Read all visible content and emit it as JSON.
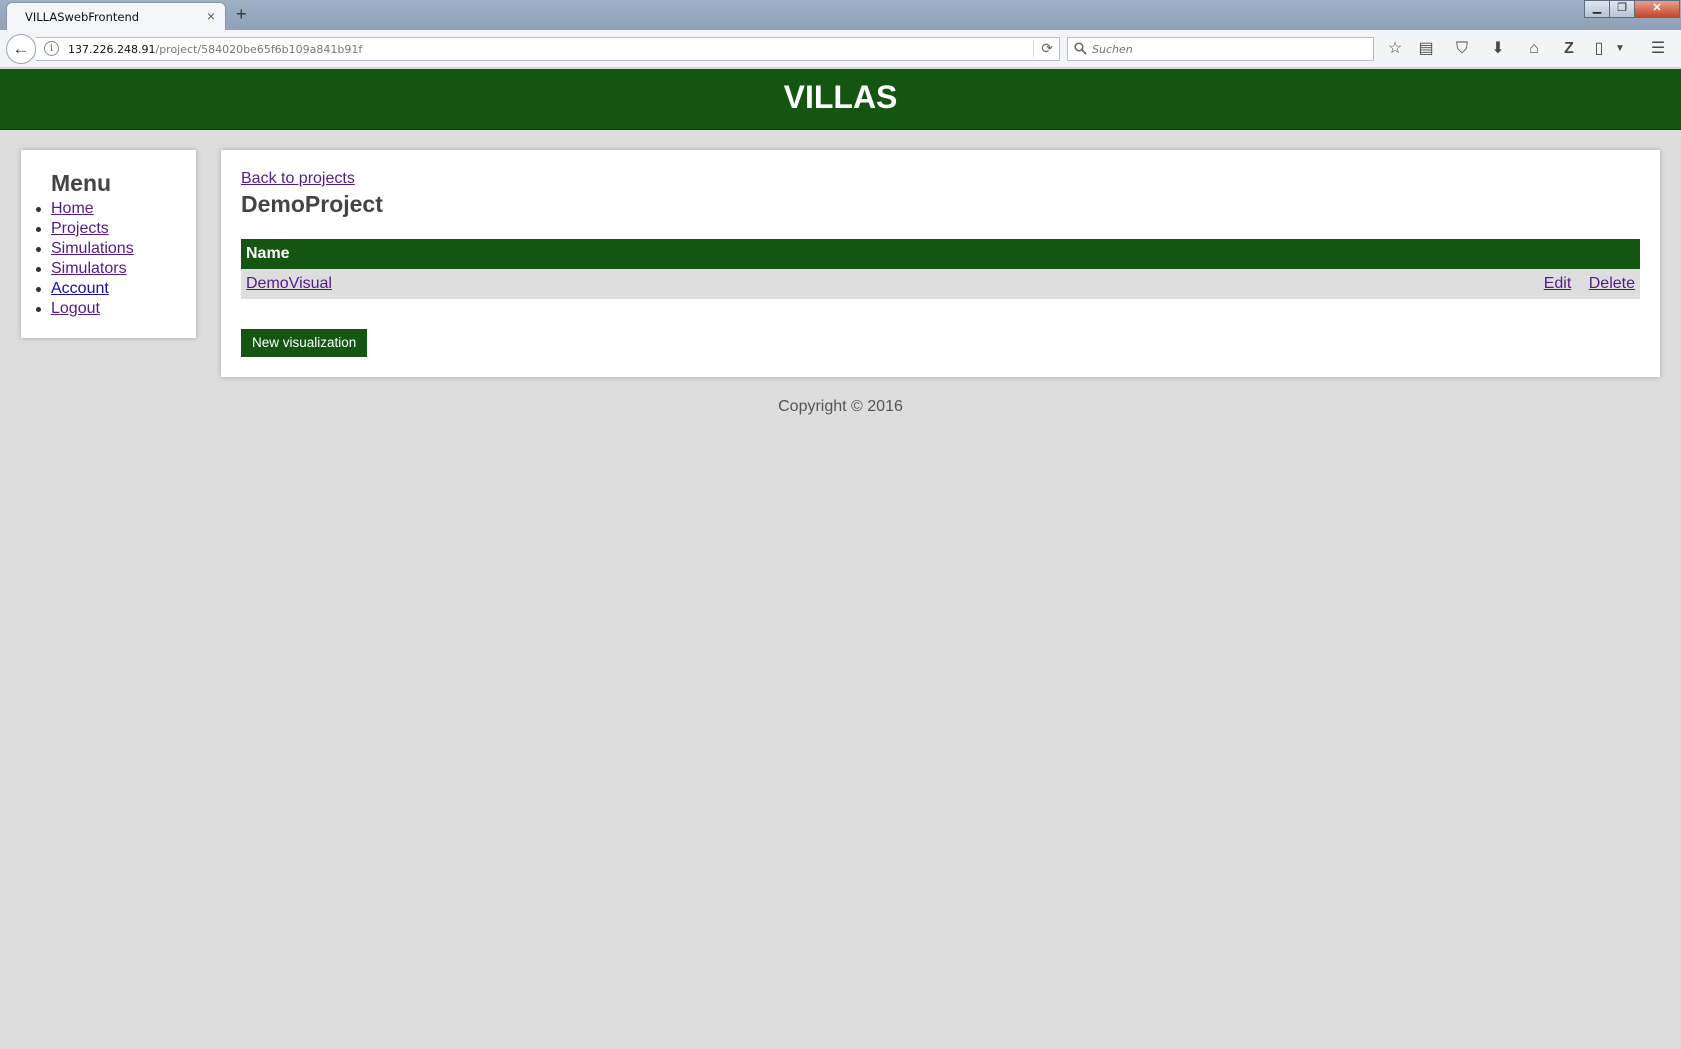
{
  "browser": {
    "tab_title": "VILLASwebFrontend",
    "tab_close": "×",
    "new_tab": "+",
    "url_host": "137.226.248.91",
    "url_path": "/project/584020be65f6b109a841b91f",
    "search_placeholder": "Suchen",
    "toolbar_icons": [
      "star-icon",
      "reading-list-icon",
      "pocket-icon",
      "download-icon",
      "home-icon",
      "zotero-icon",
      "page-icon",
      "menu-icon"
    ]
  },
  "header": {
    "title": "VILLAS"
  },
  "menu": {
    "title": "Menu",
    "items": [
      {
        "label": "Home"
      },
      {
        "label": "Projects"
      },
      {
        "label": "Simulations"
      },
      {
        "label": "Simulators"
      },
      {
        "label": "Account"
      },
      {
        "label": "Logout"
      }
    ]
  },
  "project": {
    "back_link": "Back to projects",
    "title": "DemoProject",
    "table": {
      "header": "Name",
      "rows": [
        {
          "name": "DemoVisual",
          "edit": "Edit",
          "delete": "Delete"
        }
      ]
    },
    "new_button": "New visualization"
  },
  "footer": {
    "text": "Copyright © 2016"
  },
  "colors": {
    "brand_green": "#145611",
    "background": "#dddddd",
    "visited_link": "#551a8b",
    "link": "#1a0dab"
  }
}
